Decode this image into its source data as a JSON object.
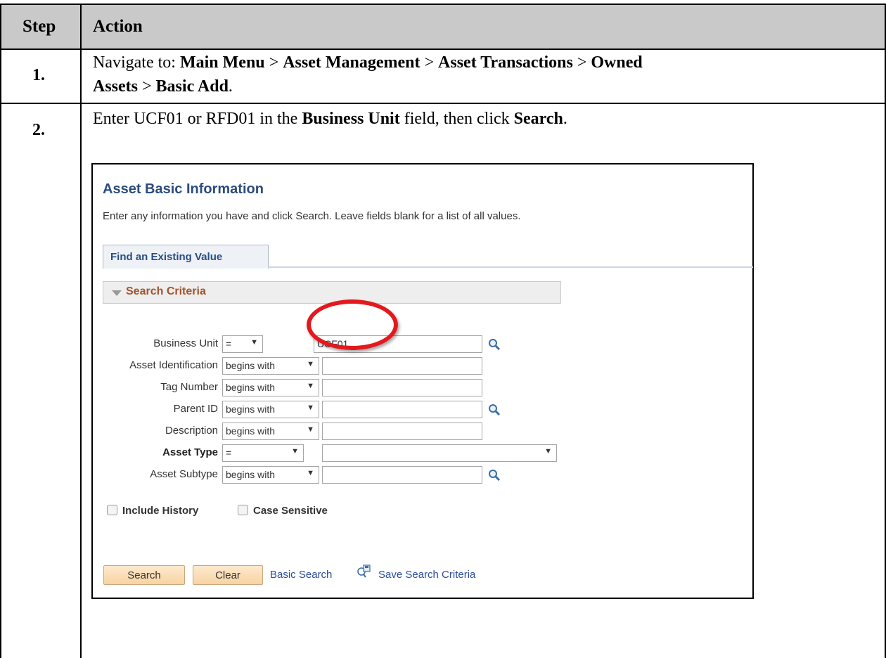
{
  "table": {
    "header": {
      "step": "Step",
      "action": "Action"
    }
  },
  "steps": [
    {
      "number": "1.",
      "parts": [
        "Navigate to: ",
        "Main Menu",
        " > ",
        "Asset Management",
        " > ",
        "Asset Transactions",
        " > ",
        "Owned",
        "Assets",
        " > ",
        "Basic Add",
        "."
      ]
    },
    {
      "number": "2.",
      "parts": [
        "Enter UCF01 or RFD01 in the ",
        "Business Unit",
        " field, then click ",
        "Search",
        "."
      ]
    }
  ],
  "screenshot": {
    "title": "Asset Basic Information",
    "description": "Enter any information you have and click Search. Leave fields blank for a list of all values.",
    "tab_label": "Find an Existing Value",
    "section_label": "Search Criteria",
    "fields": {
      "business_unit": {
        "label": "Business Unit",
        "operator": "=",
        "value": "UCF01"
      },
      "asset_id": {
        "label": "Asset Identification",
        "operator": "begins with",
        "value": ""
      },
      "tag_number": {
        "label": "Tag Number",
        "operator": "begins with",
        "value": ""
      },
      "parent_id": {
        "label": "Parent ID",
        "operator": "begins with",
        "value": ""
      },
      "description": {
        "label": "Description",
        "operator": "begins with",
        "value": ""
      },
      "asset_type": {
        "label": "Asset Type",
        "operator": "=",
        "value": ""
      },
      "asset_subtype": {
        "label": "Asset Subtype",
        "operator": "begins with",
        "value": ""
      }
    },
    "checkboxes": {
      "include_history": "Include History",
      "case_sensitive": "Case Sensitive"
    },
    "buttons": {
      "search": "Search",
      "clear": "Clear"
    },
    "links": {
      "basic_search": "Basic Search",
      "save_search": "Save Search Criteria"
    },
    "colors": {
      "title_blue": "#2b4c7e",
      "section_brown": "#a3542a",
      "highlight_red": "#e3191e",
      "button_orange": "#f8d3a2"
    }
  }
}
